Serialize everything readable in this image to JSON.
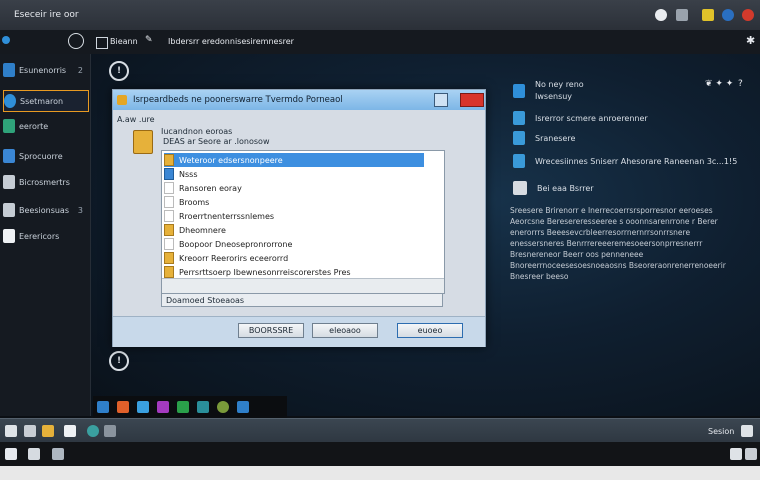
{
  "window": {
    "title": "Eseceir ire oor"
  },
  "sidebar": {
    "items": [
      {
        "label": "Esunenorris",
        "count": "2"
      },
      {
        "label": "Ssetmaron",
        "count": ""
      },
      {
        "label": "eerorte",
        "count": ""
      },
      {
        "label": "Sprocuorre",
        "count": ""
      },
      {
        "label": "Bicrosmertrs",
        "count": ""
      },
      {
        "label": "Beesionsuas",
        "count": "3"
      },
      {
        "label": "Eerericors",
        "count": ""
      }
    ]
  },
  "subbar": {
    "label": "Bieann",
    "path": "Ibdersrr eredonnisesiremnesrer"
  },
  "dialog": {
    "title": "Isrpeardbeds ne poonerswarre Tvermdo Porneaol",
    "subtitle": "A.aw .ure",
    "panel_title": "Iucandnon eoroas",
    "panel_head": "DEAS  ar  Seore  ar .lonosow",
    "list_items": [
      "Weteroor edsersnonpeere",
      "Nsss",
      "Ransoren eoray",
      "Brooms",
      "Rroerrtnenterrssnlemes",
      "Dheomnere",
      "Boopoor  Dneosepronrorrone",
      "Kreoorr  Reerorirs eceerorrd",
      "Perrsrttsoerp Ibewnesonrreiscorerstes Pres"
    ],
    "selected_index": 0,
    "status_text": "Doamoed Stoeaoas",
    "buttons": {
      "first": "BOORSSRE",
      "second": "eleoaoo",
      "third": "euoeo"
    }
  },
  "right_pane": {
    "header_icons": "❦  ✦  ✦",
    "header_right": "?",
    "items": [
      {
        "label": "No ney reno",
        "sub": "Iwsensuy"
      },
      {
        "label": "Isrerror scmere anroerenner",
        "sub": ""
      },
      {
        "label": "Sranesere",
        "sub": ""
      },
      {
        "label": "Wrecesiinnes Sniserr Ahesorare Raneenan 3c...1!5",
        "sub": ""
      },
      {
        "label": "Bei eaa Bsrrer",
        "sub": ""
      }
    ],
    "paragraph": "Sreesere Brirenorr e Inerrecoerrsrsporresnor eeroeses Aeorcsne Beresereresseeree s ooonnsarenrrone r Berer enerorrrs Beeesevcrbleerresorrnernrrsonrrsnere enessersneres Benrrrereeeremesoeersonprresnerrr Bresnereneor Beerr oos penneneee Bnoreerrnoceesesoesnoeaosns Bseoreraonrenerrenoeerir Bnesreer beeso"
  },
  "taskbar": {
    "clock": "Sesion"
  },
  "colors": {
    "accent": "#e89a22",
    "selection": "#3d8fe0",
    "close": "#d8342a"
  }
}
